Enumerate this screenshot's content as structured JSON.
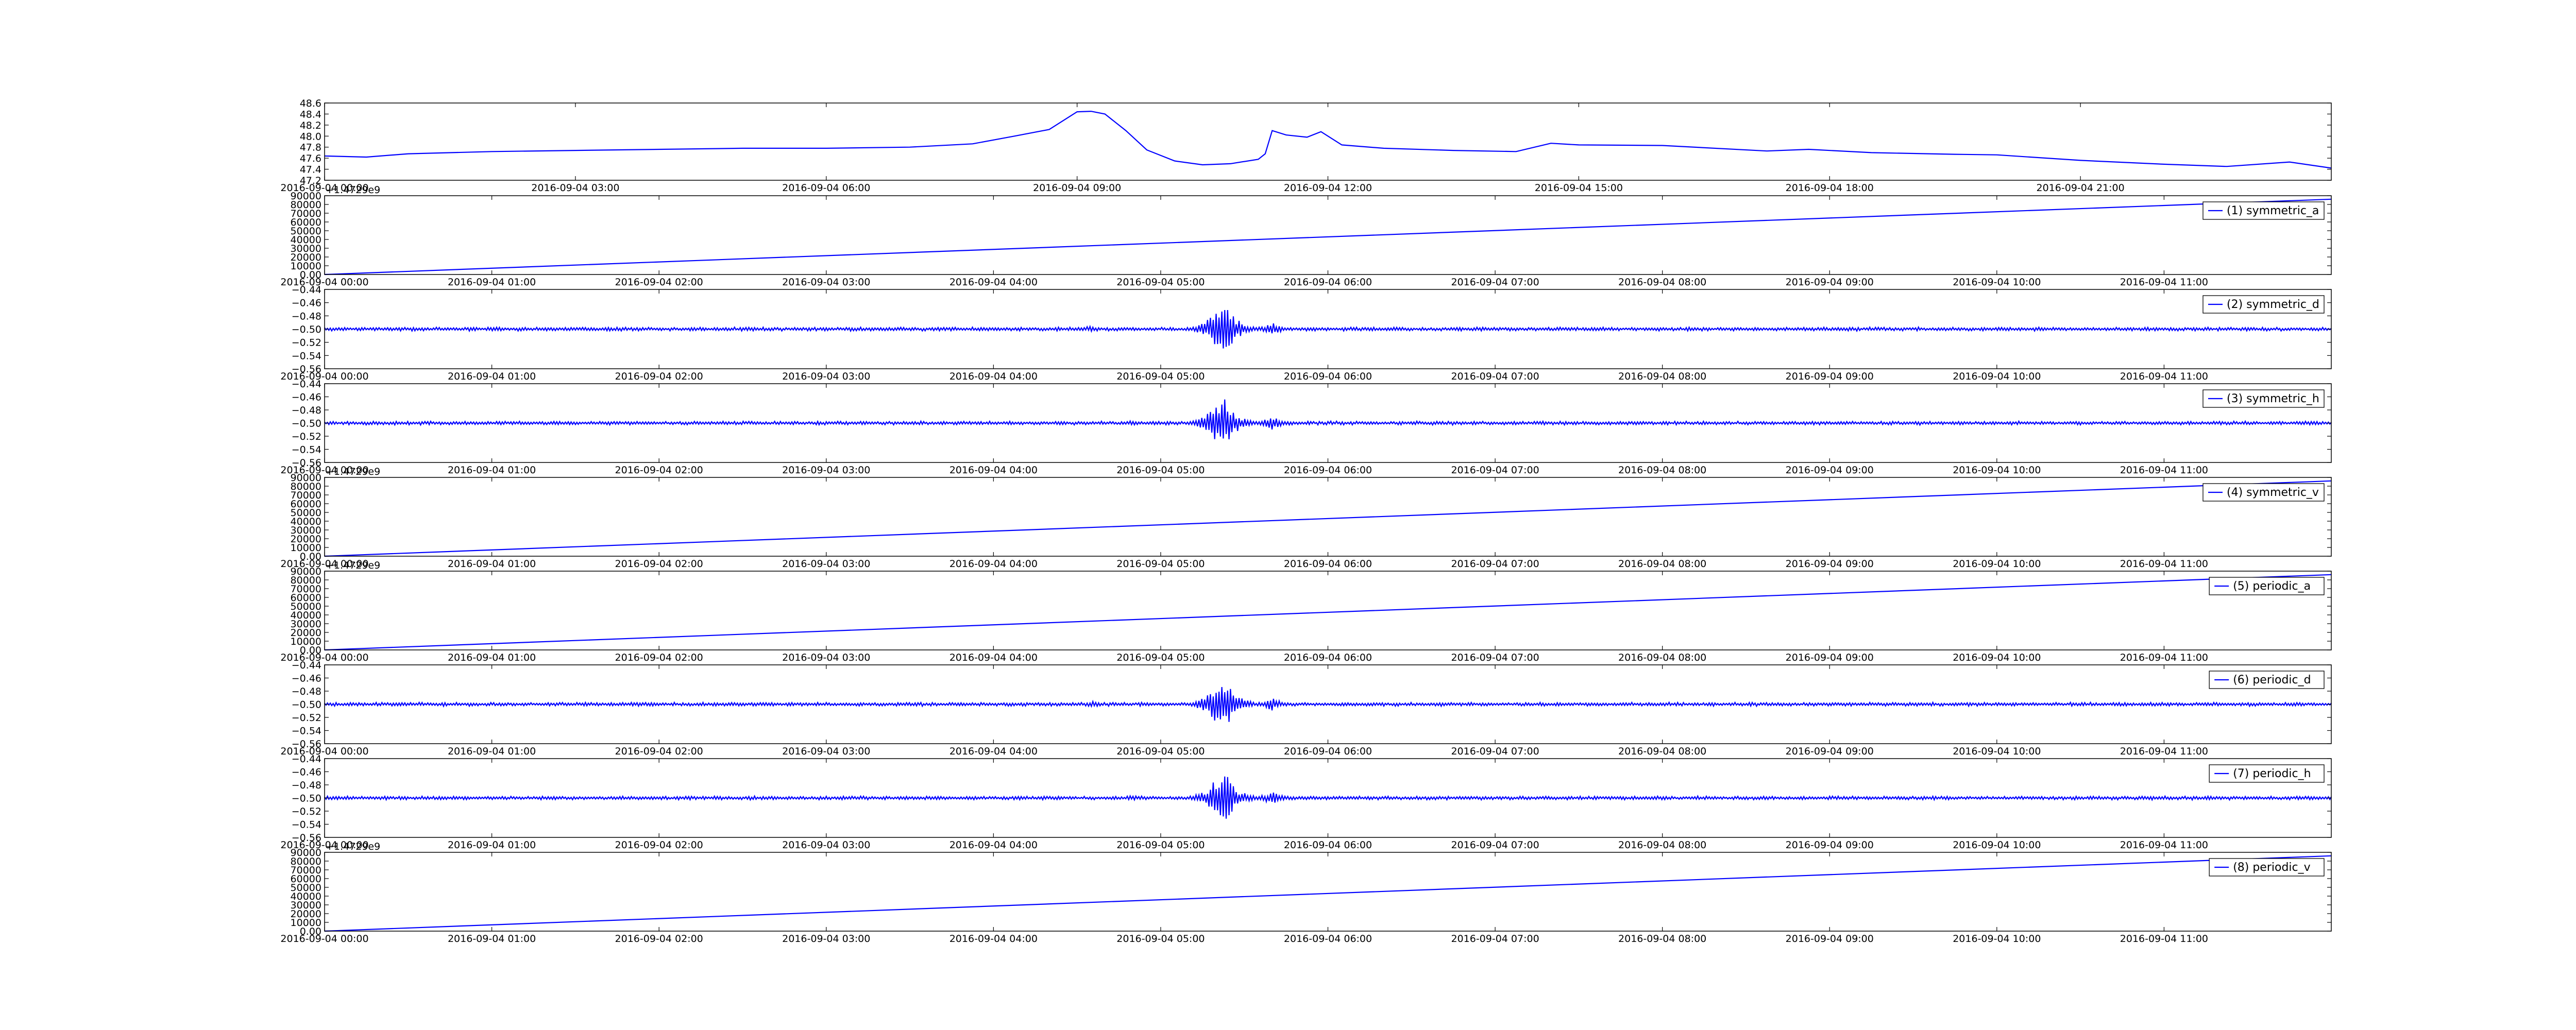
{
  "chart_data": [
    {
      "type": "line",
      "title": "",
      "xlabel": "",
      "ylabel": "",
      "x_type": "datetime",
      "xlim": [
        "2016-09-04 00:00",
        "2016-09-05 00:00"
      ],
      "x_ticks": [
        "2016-09-04 00:00",
        "2016-09-04 03:00",
        "2016-09-04 06:00",
        "2016-09-04 09:00",
        "2016-09-04 12:00",
        "2016-09-04 15:00",
        "2016-09-04 18:00",
        "2016-09-04 21:00"
      ],
      "ylim": [
        47.2,
        48.6
      ],
      "y_ticks": [
        47.2,
        47.4,
        47.6,
        47.8,
        48.0,
        48.2,
        48.4,
        48.6
      ],
      "grid": false,
      "legend": "none",
      "color": "#0000ff",
      "series": [
        {
          "x": [
            "2016-09-04 00:00",
            "2016-09-04 00:30",
            "2016-09-04 01:00",
            "2016-09-04 02:00",
            "2016-09-04 03:00",
            "2016-09-04 04:00",
            "2016-09-04 05:00",
            "2016-09-04 06:00",
            "2016-09-04 07:00",
            "2016-09-04 07:45",
            "2016-09-04 08:15",
            "2016-09-04 08:40",
            "2016-09-04 09:00",
            "2016-09-04 09:10",
            "2016-09-04 09:20",
            "2016-09-04 09:35",
            "2016-09-04 09:50",
            "2016-09-04 10:10",
            "2016-09-04 10:30",
            "2016-09-04 10:50",
            "2016-09-04 11:10",
            "2016-09-04 11:15",
            "2016-09-04 11:20",
            "2016-09-04 11:30",
            "2016-09-04 11:45",
            "2016-09-04 11:55",
            "2016-09-04 12:10",
            "2016-09-04 12:40",
            "2016-09-04 13:30",
            "2016-09-04 14:15",
            "2016-09-04 14:40",
            "2016-09-04 15:00",
            "2016-09-04 16:00",
            "2016-09-04 17:15",
            "2016-09-04 17:45",
            "2016-09-04 18:30",
            "2016-09-04 19:30",
            "2016-09-04 20:00",
            "2016-09-04 21:00",
            "2016-09-04 22:00",
            "2016-09-04 22:45",
            "2016-09-04 23:30",
            "2016-09-05 00:00"
          ],
          "y": [
            47.64,
            47.62,
            47.68,
            47.72,
            47.74,
            47.76,
            47.78,
            47.78,
            47.8,
            47.86,
            48.0,
            48.12,
            48.44,
            48.45,
            48.4,
            48.1,
            47.75,
            47.55,
            47.48,
            47.5,
            47.58,
            47.68,
            48.1,
            48.02,
            47.98,
            48.08,
            47.84,
            47.78,
            47.74,
            47.72,
            47.87,
            47.84,
            47.83,
            47.73,
            47.76,
            47.7,
            47.67,
            47.66,
            47.56,
            47.49,
            47.45,
            47.53,
            47.42
          ]
        }
      ]
    },
    {
      "type": "line",
      "title": "",
      "xlabel": "",
      "ylabel": "",
      "x_type": "datetime",
      "xlim": [
        "2016-09-04 00:00",
        "2016-09-04 12:00"
      ],
      "x_ticks": [
        "2016-09-04 00:00",
        "2016-09-04 01:00",
        "2016-09-04 02:00",
        "2016-09-04 03:00",
        "2016-09-04 04:00",
        "2016-09-04 05:00",
        "2016-09-04 06:00",
        "2016-09-04 07:00",
        "2016-09-04 08:00",
        "2016-09-04 09:00",
        "2016-09-04 10:00",
        "2016-09-04 11:00"
      ],
      "offset_text": "+1.4729e9",
      "ylim": [
        0,
        90000
      ],
      "y_ticks": [
        0,
        10000,
        20000,
        30000,
        40000,
        50000,
        60000,
        70000,
        80000,
        90000
      ],
      "legend": "top-right",
      "color": "#0000ff",
      "series": [
        {
          "name": "(1) symmetric_a",
          "x": [
            "2016-09-04 00:00",
            "2016-09-04 12:00"
          ],
          "y": [
            0,
            86000
          ]
        }
      ]
    },
    {
      "type": "line",
      "xlabel": "",
      "ylabel": "",
      "x_type": "datetime",
      "xlim": [
        "2016-09-04 00:00",
        "2016-09-04 12:00"
      ],
      "x_ticks": [
        "2016-09-04 00:00",
        "2016-09-04 01:00",
        "2016-09-04 02:00",
        "2016-09-04 03:00",
        "2016-09-04 04:00",
        "2016-09-04 05:00",
        "2016-09-04 06:00",
        "2016-09-04 07:00",
        "2016-09-04 08:00",
        "2016-09-04 09:00",
        "2016-09-04 10:00",
        "2016-09-04 11:00"
      ],
      "ylim": [
        -0.56,
        -0.44
      ],
      "y_ticks": [
        -0.56,
        -0.54,
        -0.52,
        -0.5,
        -0.48,
        -0.46,
        -0.44
      ],
      "legend": "top-right",
      "color": "#0000ff",
      "series": [
        {
          "name": "(2) symmetric_d",
          "baseline": -0.5,
          "x": [
            "2016-09-04 00:00",
            "2016-09-04 04:35",
            "2016-09-04 05:20",
            "2016-09-04 05:23",
            "2016-09-04 05:26",
            "2016-09-04 05:40",
            "2016-09-04 12:00"
          ],
          "y": [
            -0.5,
            -0.505,
            -0.468,
            -0.545,
            -0.48,
            -0.51,
            -0.5
          ]
        }
      ]
    },
    {
      "type": "line",
      "xlabel": "",
      "ylabel": "",
      "x_type": "datetime",
      "xlim": [
        "2016-09-04 00:00",
        "2016-09-04 12:00"
      ],
      "x_ticks": [
        "2016-09-04 00:00",
        "2016-09-04 01:00",
        "2016-09-04 02:00",
        "2016-09-04 03:00",
        "2016-09-04 04:00",
        "2016-09-04 05:00",
        "2016-09-04 06:00",
        "2016-09-04 07:00",
        "2016-09-04 08:00",
        "2016-09-04 09:00",
        "2016-09-04 10:00",
        "2016-09-04 11:00"
      ],
      "ylim": [
        -0.56,
        -0.44
      ],
      "y_ticks": [
        -0.56,
        -0.54,
        -0.52,
        -0.5,
        -0.48,
        -0.46,
        -0.44
      ],
      "legend": "top-right",
      "color": "#0000ff",
      "series": [
        {
          "name": "(3) symmetric_h",
          "baseline": -0.5,
          "x": [
            "2016-09-04 00:00",
            "2016-09-04 04:50",
            "2016-09-04 05:20",
            "2016-09-04 05:23",
            "2016-09-04 05:26",
            "2016-09-04 05:40",
            "2016-09-04 12:00"
          ],
          "y": [
            -0.5,
            -0.496,
            -0.468,
            -0.545,
            -0.48,
            -0.51,
            -0.5
          ]
        }
      ]
    },
    {
      "type": "line",
      "xlabel": "",
      "ylabel": "",
      "x_type": "datetime",
      "xlim": [
        "2016-09-04 00:00",
        "2016-09-04 12:00"
      ],
      "x_ticks": [
        "2016-09-04 00:00",
        "2016-09-04 01:00",
        "2016-09-04 02:00",
        "2016-09-04 03:00",
        "2016-09-04 04:00",
        "2016-09-04 05:00",
        "2016-09-04 06:00",
        "2016-09-04 07:00",
        "2016-09-04 08:00",
        "2016-09-04 09:00",
        "2016-09-04 10:00",
        "2016-09-04 11:00"
      ],
      "offset_text": "+1.4729e9",
      "ylim": [
        0,
        90000
      ],
      "y_ticks": [
        0,
        10000,
        20000,
        30000,
        40000,
        50000,
        60000,
        70000,
        80000,
        90000
      ],
      "legend": "top-right",
      "color": "#0000ff",
      "series": [
        {
          "name": "(4) symmetric_v",
          "x": [
            "2016-09-04 00:00",
            "2016-09-04 12:00"
          ],
          "y": [
            0,
            86000
          ]
        }
      ]
    },
    {
      "type": "line",
      "xlabel": "",
      "ylabel": "",
      "x_type": "datetime",
      "xlim": [
        "2016-09-04 00:00",
        "2016-09-04 12:00"
      ],
      "x_ticks": [
        "2016-09-04 00:00",
        "2016-09-04 01:00",
        "2016-09-04 02:00",
        "2016-09-04 03:00",
        "2016-09-04 04:00",
        "2016-09-04 05:00",
        "2016-09-04 06:00",
        "2016-09-04 07:00",
        "2016-09-04 08:00",
        "2016-09-04 09:00",
        "2016-09-04 10:00",
        "2016-09-04 11:00"
      ],
      "offset_text": "+1.4729e9",
      "ylim": [
        0,
        90000
      ],
      "y_ticks": [
        0,
        10000,
        20000,
        30000,
        40000,
        50000,
        60000,
        70000,
        80000,
        90000
      ],
      "legend": "top-right",
      "color": "#0000ff",
      "series": [
        {
          "name": "(5) periodic_a",
          "x": [
            "2016-09-04 00:00",
            "2016-09-04 12:00"
          ],
          "y": [
            0,
            86000
          ]
        }
      ]
    },
    {
      "type": "line",
      "xlabel": "",
      "ylabel": "",
      "x_type": "datetime",
      "xlim": [
        "2016-09-04 00:00",
        "2016-09-04 12:00"
      ],
      "x_ticks": [
        "2016-09-04 00:00",
        "2016-09-04 01:00",
        "2016-09-04 02:00",
        "2016-09-04 03:00",
        "2016-09-04 04:00",
        "2016-09-04 05:00",
        "2016-09-04 06:00",
        "2016-09-04 07:00",
        "2016-09-04 08:00",
        "2016-09-04 09:00",
        "2016-09-04 10:00",
        "2016-09-04 11:00"
      ],
      "ylim": [
        -0.56,
        -0.44
      ],
      "y_ticks": [
        -0.56,
        -0.54,
        -0.52,
        -0.5,
        -0.48,
        -0.46,
        -0.44
      ],
      "legend": "top-right",
      "color": "#0000ff",
      "series": [
        {
          "name": "(6) periodic_d",
          "baseline": -0.5,
          "x": [
            "2016-09-04 00:00",
            "2016-09-04 04:35",
            "2016-09-04 05:20",
            "2016-09-04 05:23",
            "2016-09-04 05:26",
            "2016-09-04 05:40",
            "2016-09-04 12:00"
          ],
          "y": [
            -0.5,
            -0.505,
            -0.468,
            -0.545,
            -0.48,
            -0.51,
            -0.5
          ]
        }
      ]
    },
    {
      "type": "line",
      "xlabel": "",
      "ylabel": "",
      "x_type": "datetime",
      "xlim": [
        "2016-09-04 00:00",
        "2016-09-04 12:00"
      ],
      "x_ticks": [
        "2016-09-04 00:00",
        "2016-09-04 01:00",
        "2016-09-04 02:00",
        "2016-09-04 03:00",
        "2016-09-04 04:00",
        "2016-09-04 05:00",
        "2016-09-04 06:00",
        "2016-09-04 07:00",
        "2016-09-04 08:00",
        "2016-09-04 09:00",
        "2016-09-04 10:00",
        "2016-09-04 11:00"
      ],
      "ylim": [
        -0.56,
        -0.44
      ],
      "y_ticks": [
        -0.56,
        -0.54,
        -0.52,
        -0.5,
        -0.48,
        -0.46,
        -0.44
      ],
      "legend": "top-right",
      "color": "#0000ff",
      "series": [
        {
          "name": "(7) periodic_h",
          "baseline": -0.5,
          "x": [
            "2016-09-04 00:00",
            "2016-09-04 04:50",
            "2016-09-04 05:20",
            "2016-09-04 05:23",
            "2016-09-04 05:26",
            "2016-09-04 05:40",
            "2016-09-04 12:00"
          ],
          "y": [
            -0.5,
            -0.496,
            -0.468,
            -0.545,
            -0.48,
            -0.51,
            -0.5
          ]
        }
      ]
    },
    {
      "type": "line",
      "xlabel": "",
      "ylabel": "",
      "x_type": "datetime",
      "xlim": [
        "2016-09-04 00:00",
        "2016-09-04 12:00"
      ],
      "x_ticks": [
        "2016-09-04 00:00",
        "2016-09-04 01:00",
        "2016-09-04 02:00",
        "2016-09-04 03:00",
        "2016-09-04 04:00",
        "2016-09-04 05:00",
        "2016-09-04 06:00",
        "2016-09-04 07:00",
        "2016-09-04 08:00",
        "2016-09-04 09:00",
        "2016-09-04 10:00",
        "2016-09-04 11:00"
      ],
      "offset_text": "+1.4729e9",
      "ylim": [
        0,
        90000
      ],
      "y_ticks": [
        0,
        10000,
        20000,
        30000,
        40000,
        50000,
        60000,
        70000,
        80000,
        90000
      ],
      "legend": "top-right",
      "color": "#0000ff",
      "series": [
        {
          "name": "(8) periodic_v",
          "x": [
            "2016-09-04 00:00",
            "2016-09-04 12:00"
          ],
          "y": [
            0,
            86000
          ]
        }
      ]
    }
  ]
}
